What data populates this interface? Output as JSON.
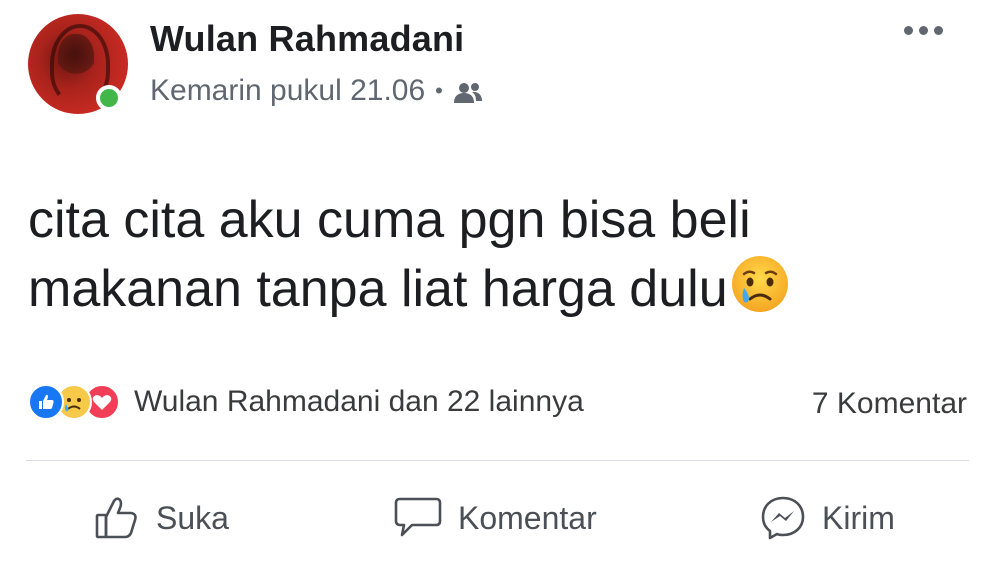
{
  "post": {
    "author": "Wulan Rahmadani",
    "timestamp": "Kemarin pukul 21.06",
    "separator": "•",
    "audience_icon": "friends-icon",
    "text_line1": "cita cita aku cuma pgn bisa beli",
    "text_line2": "makanan tanpa liat harga dulu",
    "emoji": "sad-but-relieved-face"
  },
  "reactions": {
    "icons": [
      "like",
      "sad",
      "love"
    ],
    "summary": "Wulan Rahmadani dan 22 lainnya",
    "comments": "7 Komentar"
  },
  "actions": {
    "like": "Suka",
    "comment": "Komentar",
    "share": "Kirim"
  },
  "colors": {
    "online": "#43b649",
    "like_blue": "#1877f2",
    "love_red": "#f33e58",
    "sad_yellow": "#f7c948",
    "secondary_text": "#606770"
  }
}
